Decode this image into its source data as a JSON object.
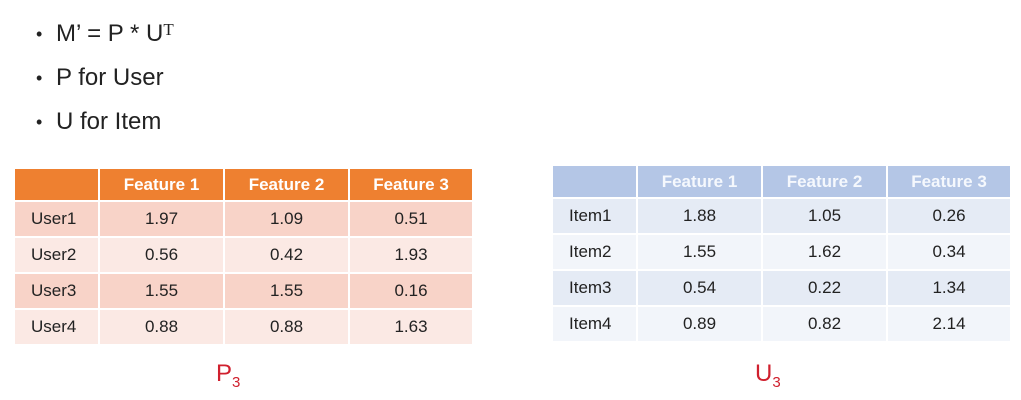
{
  "bullets": [
    {
      "text": "M’ = P * U",
      "sup": "T"
    },
    {
      "text": "P for User"
    },
    {
      "text": "U for Item"
    }
  ],
  "p_table": {
    "headers": [
      "",
      "Feature 1",
      "Feature 2",
      "Feature 3"
    ],
    "rows": [
      [
        "User1",
        "1.97",
        "1.09",
        "0.51"
      ],
      [
        "User2",
        "0.56",
        "0.42",
        "1.93"
      ],
      [
        "User3",
        "1.55",
        "1.55",
        "0.16"
      ],
      [
        "User4",
        "0.88",
        "0.88",
        "1.63"
      ]
    ],
    "caption": "P",
    "caption_sub": "3"
  },
  "u_table": {
    "headers": [
      "",
      "Feature 1",
      "Feature 2",
      "Feature 3"
    ],
    "rows": [
      [
        "Item1",
        "1.88",
        "1.05",
        "0.26"
      ],
      [
        "Item2",
        "1.55",
        "1.62",
        "0.34"
      ],
      [
        "Item3",
        "0.54",
        "0.22",
        "1.34"
      ],
      [
        "Item4",
        "0.89",
        "0.82",
        "2.14"
      ]
    ],
    "caption": "U",
    "caption_sub": "3"
  }
}
